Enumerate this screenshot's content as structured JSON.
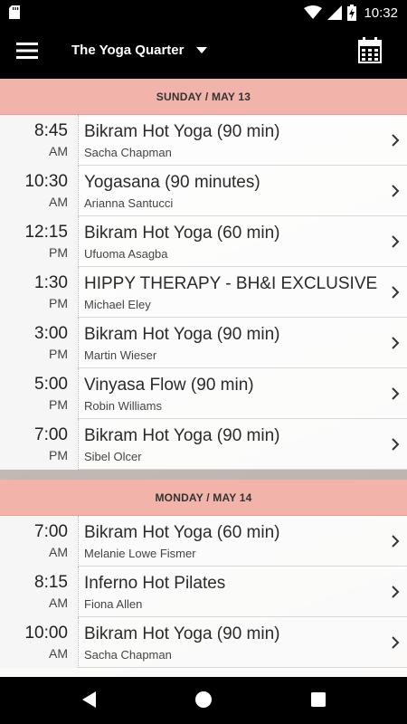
{
  "status_bar": {
    "time": "10:32",
    "icons": [
      "sd-card-icon",
      "wifi-icon",
      "signal-icon",
      "battery-charging-icon"
    ]
  },
  "app_bar": {
    "title": "The Yoga Quarter",
    "icons": [
      "hamburger-menu-icon",
      "dropdown-caret-icon",
      "calendar-icon"
    ]
  },
  "days": [
    {
      "header": "SUNDAY / MAY 13",
      "classes": [
        {
          "time": "8:45",
          "ampm": "AM",
          "name": "Bikram Hot Yoga (90 min)",
          "instructor": "Sacha Chapman"
        },
        {
          "time": "10:30",
          "ampm": "AM",
          "name": "Yogasana (90 minutes)",
          "instructor": "Arianna Santucci"
        },
        {
          "time": "12:15",
          "ampm": "PM",
          "name": "Bikram Hot Yoga (60 min)",
          "instructor": "Ufuoma Asagba"
        },
        {
          "time": "1:30",
          "ampm": "PM",
          "name": "HIPPY THERAPY - BH&I EXCLUSIVE",
          "instructor": "Michael Eley"
        },
        {
          "time": "3:00",
          "ampm": "PM",
          "name": "Bikram Hot Yoga (90 min)",
          "instructor": "Martin Wieser"
        },
        {
          "time": "5:00",
          "ampm": "PM",
          "name": "Vinyasa Flow (90 min)",
          "instructor": "Robin Williams"
        },
        {
          "time": "7:00",
          "ampm": "PM",
          "name": "Bikram Hot Yoga (90 min)",
          "instructor": "Sibel Olcer"
        }
      ]
    },
    {
      "header": "MONDAY / MAY 14",
      "classes": [
        {
          "time": "7:00",
          "ampm": "AM",
          "name": "Bikram Hot Yoga (60 min)",
          "instructor": "Melanie Lowe Fismer"
        },
        {
          "time": "8:15",
          "ampm": "AM",
          "name": "Inferno Hot Pilates",
          "instructor": "Fiona Allen"
        },
        {
          "time": "10:00",
          "ampm": "AM",
          "name": "Bikram Hot Yoga (90 min)",
          "instructor": "Sacha Chapman"
        }
      ]
    }
  ],
  "nav_bar": {
    "icons": [
      "back-icon",
      "home-icon",
      "recents-icon"
    ]
  },
  "colors": {
    "day_header": "#f2b4aa",
    "bar": "#000000"
  }
}
